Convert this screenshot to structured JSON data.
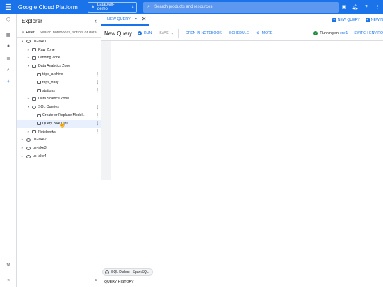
{
  "header": {
    "logo_text": "Google Cloud Platform",
    "project": "dataplex-demo",
    "search_placeholder": "Search products and resources"
  },
  "explorer": {
    "title": "Explorer",
    "filter_label": "Filter",
    "filter_placeholder": "Search notebooks, scripts or data"
  },
  "tree": [
    {
      "label": "us-lake1"
    },
    {
      "label": "Raw Zone"
    },
    {
      "label": "Landing Zone"
    },
    {
      "label": "Data Analytics Zone"
    },
    {
      "label": "trips_archive"
    },
    {
      "label": "trips_daily"
    },
    {
      "label": "stations"
    },
    {
      "label": "Data Science Zone"
    },
    {
      "label": "SQL Queries"
    },
    {
      "label": "Create or Replace Model..."
    },
    {
      "label": "Query BikeTrips"
    },
    {
      "label": "Notebooks"
    },
    {
      "label": "us-lake2"
    },
    {
      "label": "us-lake3"
    },
    {
      "label": "us-lake4"
    }
  ],
  "tabs": {
    "active": "NEW QUERY",
    "right_1": "NEW QUERY",
    "right_2": "NEW N"
  },
  "toolbar": {
    "title": "New Query",
    "run": "RUN",
    "save": "SAVE",
    "open_notebook": "OPEN IN NOTEBOOK",
    "schedule": "SCHEDULE",
    "more": "MORE",
    "status_prefix": "Running on",
    "status_env": "env1",
    "switch": "SWITCH ENVIRO"
  },
  "footer": {
    "dialect": "SQL Dialect : SparkSQL",
    "query_history": "QUERY HISTORY"
  }
}
